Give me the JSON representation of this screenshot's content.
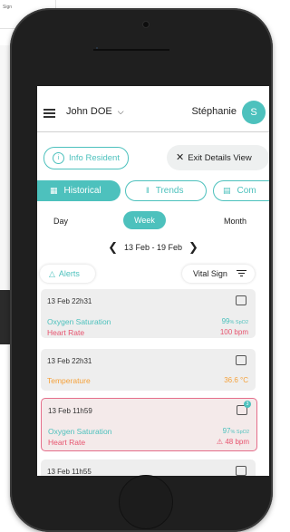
{
  "background": {
    "corner_text": "Sign"
  },
  "header": {
    "resident_name": "John DOE",
    "user_name": "Stéphanie",
    "avatar_initial": "S"
  },
  "actions": {
    "info_label": "Info Resident",
    "exit_label": "Exit Details View"
  },
  "tabs": [
    {
      "label": "Historical",
      "icon": "calendar-icon",
      "active": true
    },
    {
      "label": "Trends",
      "icon": "bars-icon",
      "active": false
    },
    {
      "label": "Com",
      "icon": "comment-icon",
      "active": false
    }
  ],
  "periods": {
    "day": "Day",
    "week": "Week",
    "month": "Month",
    "selected": "Week"
  },
  "date_range": "13 Feb - 19 Feb",
  "filters": {
    "alerts_label": "Alerts",
    "vital_label": "Vital Sign"
  },
  "cards": [
    {
      "time": "13 Feb 22h31",
      "alert": false,
      "measurements": [
        {
          "name": "Oxygen Saturation",
          "value": "99",
          "unit": "% SpO2",
          "color": "teal"
        },
        {
          "name": "Heart Rate",
          "value": "100 bpm",
          "unit": "",
          "color": "pink"
        }
      ]
    },
    {
      "time": "13 Feb 22h31",
      "alert": false,
      "measurements": [
        {
          "name": "Temperature",
          "value": "36.6 °C",
          "unit": "",
          "color": "orange"
        }
      ]
    },
    {
      "time": "13 Feb 11h59",
      "alert": true,
      "comment_count": "3",
      "measurements": [
        {
          "name": "Oxygen Saturation",
          "value": "97",
          "unit": "% SpO2",
          "color": "teal"
        },
        {
          "name": "Heart Rate",
          "value": "⚠ 48 bpm",
          "unit": "",
          "color": "pink"
        }
      ]
    },
    {
      "time": "13 Feb 11h55",
      "alert": false,
      "measurements": []
    }
  ],
  "colors": {
    "accent": "#4dc1bd",
    "heart": "#e7546f",
    "temperature": "#f5a13a",
    "alert_border": "#e56d8a"
  }
}
